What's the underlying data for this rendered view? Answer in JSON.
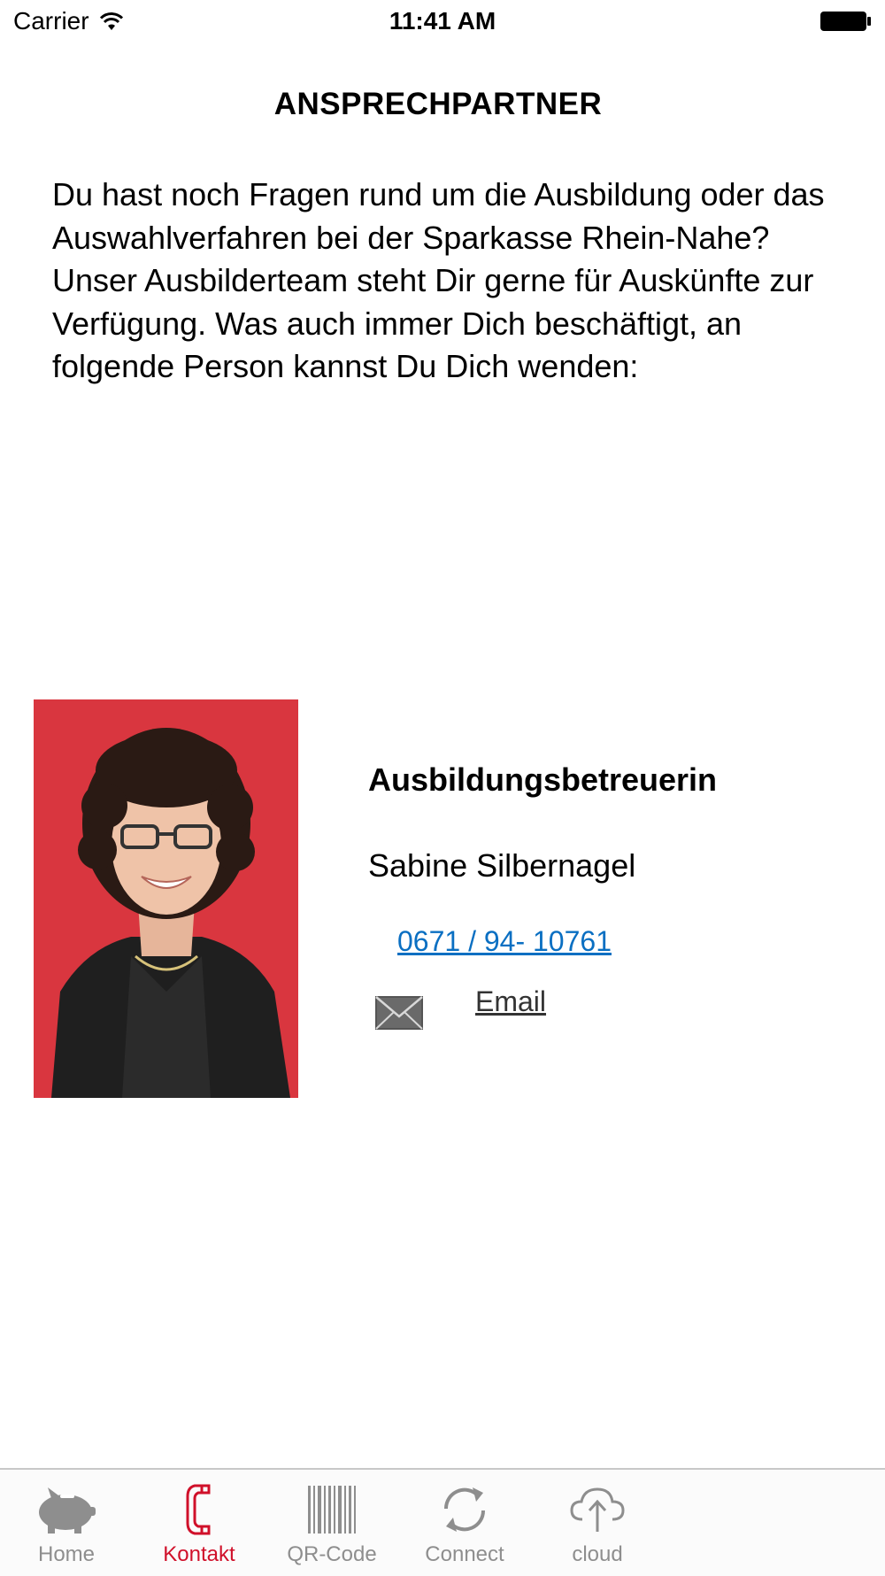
{
  "status_bar": {
    "carrier": "Carrier",
    "time": "11:41 AM",
    "icons": [
      "wifi-icon",
      "battery-icon"
    ]
  },
  "page": {
    "title": "ANSPRECHPARTNER",
    "intro": "Du hast noch Fragen rund um die Ausbildung oder das Auswahlverfahren bei der Sparkasse Rhein-Nahe? Unser Ausbilderteam steht Dir gerne für Auskünfte zur Verfügung. Was auch immer Dich beschäftigt, an folgende Person kannst Du Dich wenden:"
  },
  "contact": {
    "role": "Ausbildungsbetreuerin",
    "name": "Sabine Silbernagel",
    "phone": "0671 / 94- 10761",
    "email_label": "Email",
    "photo_background": "#d9363f"
  },
  "tab_bar": {
    "active_color": "#d0102a",
    "inactive_color": "#8e8e8e",
    "tabs": [
      {
        "label": "Home",
        "icon": "piggy-bank-icon"
      },
      {
        "label": "Kontakt",
        "icon": "phone-handset-icon"
      },
      {
        "label": "QR-Code",
        "icon": "barcode-icon"
      },
      {
        "label": "Connect",
        "icon": "sync-icon"
      },
      {
        "label": "cloud",
        "icon": "cloud-upload-icon"
      }
    ]
  }
}
